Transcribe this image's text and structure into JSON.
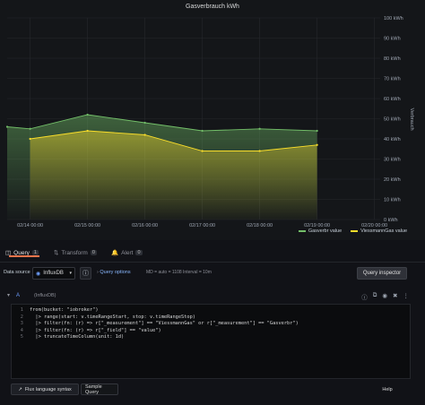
{
  "panel": {
    "title": "Gasverbrauch kWh"
  },
  "chart_data": {
    "type": "area",
    "title": "Gasverbrauch kWh",
    "ylabel": "Verbrauch",
    "ylim": [
      0,
      100
    ],
    "y_ticks": [
      "100 kWh",
      "90 kWh",
      "80 kWh",
      "70 kWh",
      "60 kWh",
      "50 kWh",
      "40 kWh",
      "30 kWh",
      "20 kWh",
      "10 kWh",
      "0 kWh"
    ],
    "x_ticks": [
      "02/14 00:00",
      "02/15 00:00",
      "02/16 00:00",
      "02/17 00:00",
      "02/18 00:00",
      "02/19 00:00",
      "02/20 00:00"
    ],
    "x_range_days": [
      13.6,
      20.1
    ],
    "series": [
      {
        "name": "Gasverbr value",
        "color": "#73bf69",
        "x": [
          13.6,
          14.0,
          15.0,
          16.0,
          17.0,
          18.0,
          19.0
        ],
        "y": [
          46,
          45,
          52,
          48,
          44,
          45,
          44
        ]
      },
      {
        "name": "ViessmannGas value",
        "color": "#fade2a",
        "x": [
          14.0,
          15.0,
          16.0,
          17.0,
          18.0,
          19.0
        ],
        "y": [
          40,
          44,
          42,
          34,
          34,
          37
        ]
      }
    ]
  },
  "tabs": [
    {
      "label": "Query",
      "count": "1",
      "icon": "database-icon"
    },
    {
      "label": "Transform",
      "count": "0",
      "icon": "transform-icon"
    },
    {
      "label": "Alert",
      "count": "0",
      "icon": "bell-icon"
    }
  ],
  "datasource": {
    "label": "Data source",
    "selected": "InfluxDB",
    "query_options": "Query options",
    "meta": "MD = auto = 1108   Interval = 10m",
    "inspector": "Query inspector"
  },
  "query": {
    "letter": "A",
    "ds": "(InfluxDB)",
    "lines": [
      {
        "n": "1",
        "text": "from(bucket: \"iobroker\")"
      },
      {
        "n": "2",
        "text": "  |> range(start: v.timeRangeStart, stop: v.timeRangeStop)"
      },
      {
        "n": "3",
        "text": "  |> filter(fn: (r) => r[\"_measurement\"] == \"ViessmannGas\" or r[\"_measurement\"] == \"Gasverbr\")"
      },
      {
        "n": "4",
        "text": "  |> filter(fn: (r) => r[\"_field\"] == \"value\")"
      },
      {
        "n": "5",
        "text": "  |> truncateTimeColumn(unit: 1d)"
      }
    ]
  },
  "footer": {
    "flux": "Flux language syntax",
    "sample": "Sample Query",
    "help": "Help"
  }
}
